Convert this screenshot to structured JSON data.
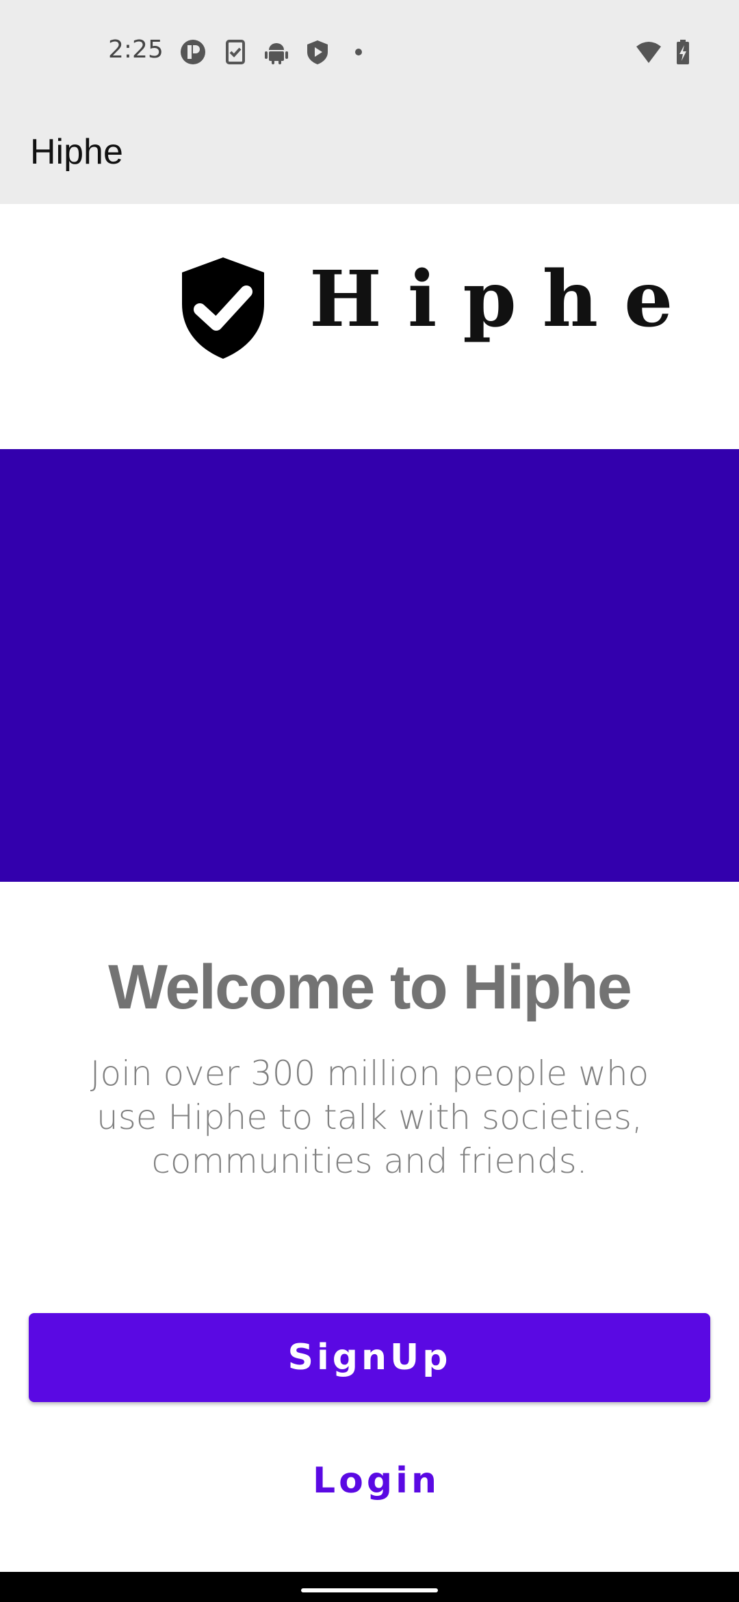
{
  "status_bar": {
    "time": "2:25",
    "icons": [
      "app-notification-icon",
      "task-check-icon",
      "android-icon",
      "shield-play-icon",
      "dot-icon",
      "wifi-icon",
      "battery-charging-icon"
    ]
  },
  "app_bar": {
    "title": "Hiphe"
  },
  "logo": {
    "icon": "shield-check-icon",
    "text": "Hiphe"
  },
  "banner": {
    "color": "#3300ad"
  },
  "welcome": {
    "title": "Welcome to Hiphe",
    "description": "Join over 300 million people who use Hiphe to talk with societies, communities and friends."
  },
  "actions": {
    "signup_label": "SignUp",
    "login_label": "Login"
  },
  "colors": {
    "accent": "#5a09e3",
    "app_bar_bg": "#ececec",
    "title_gray": "#737373"
  }
}
